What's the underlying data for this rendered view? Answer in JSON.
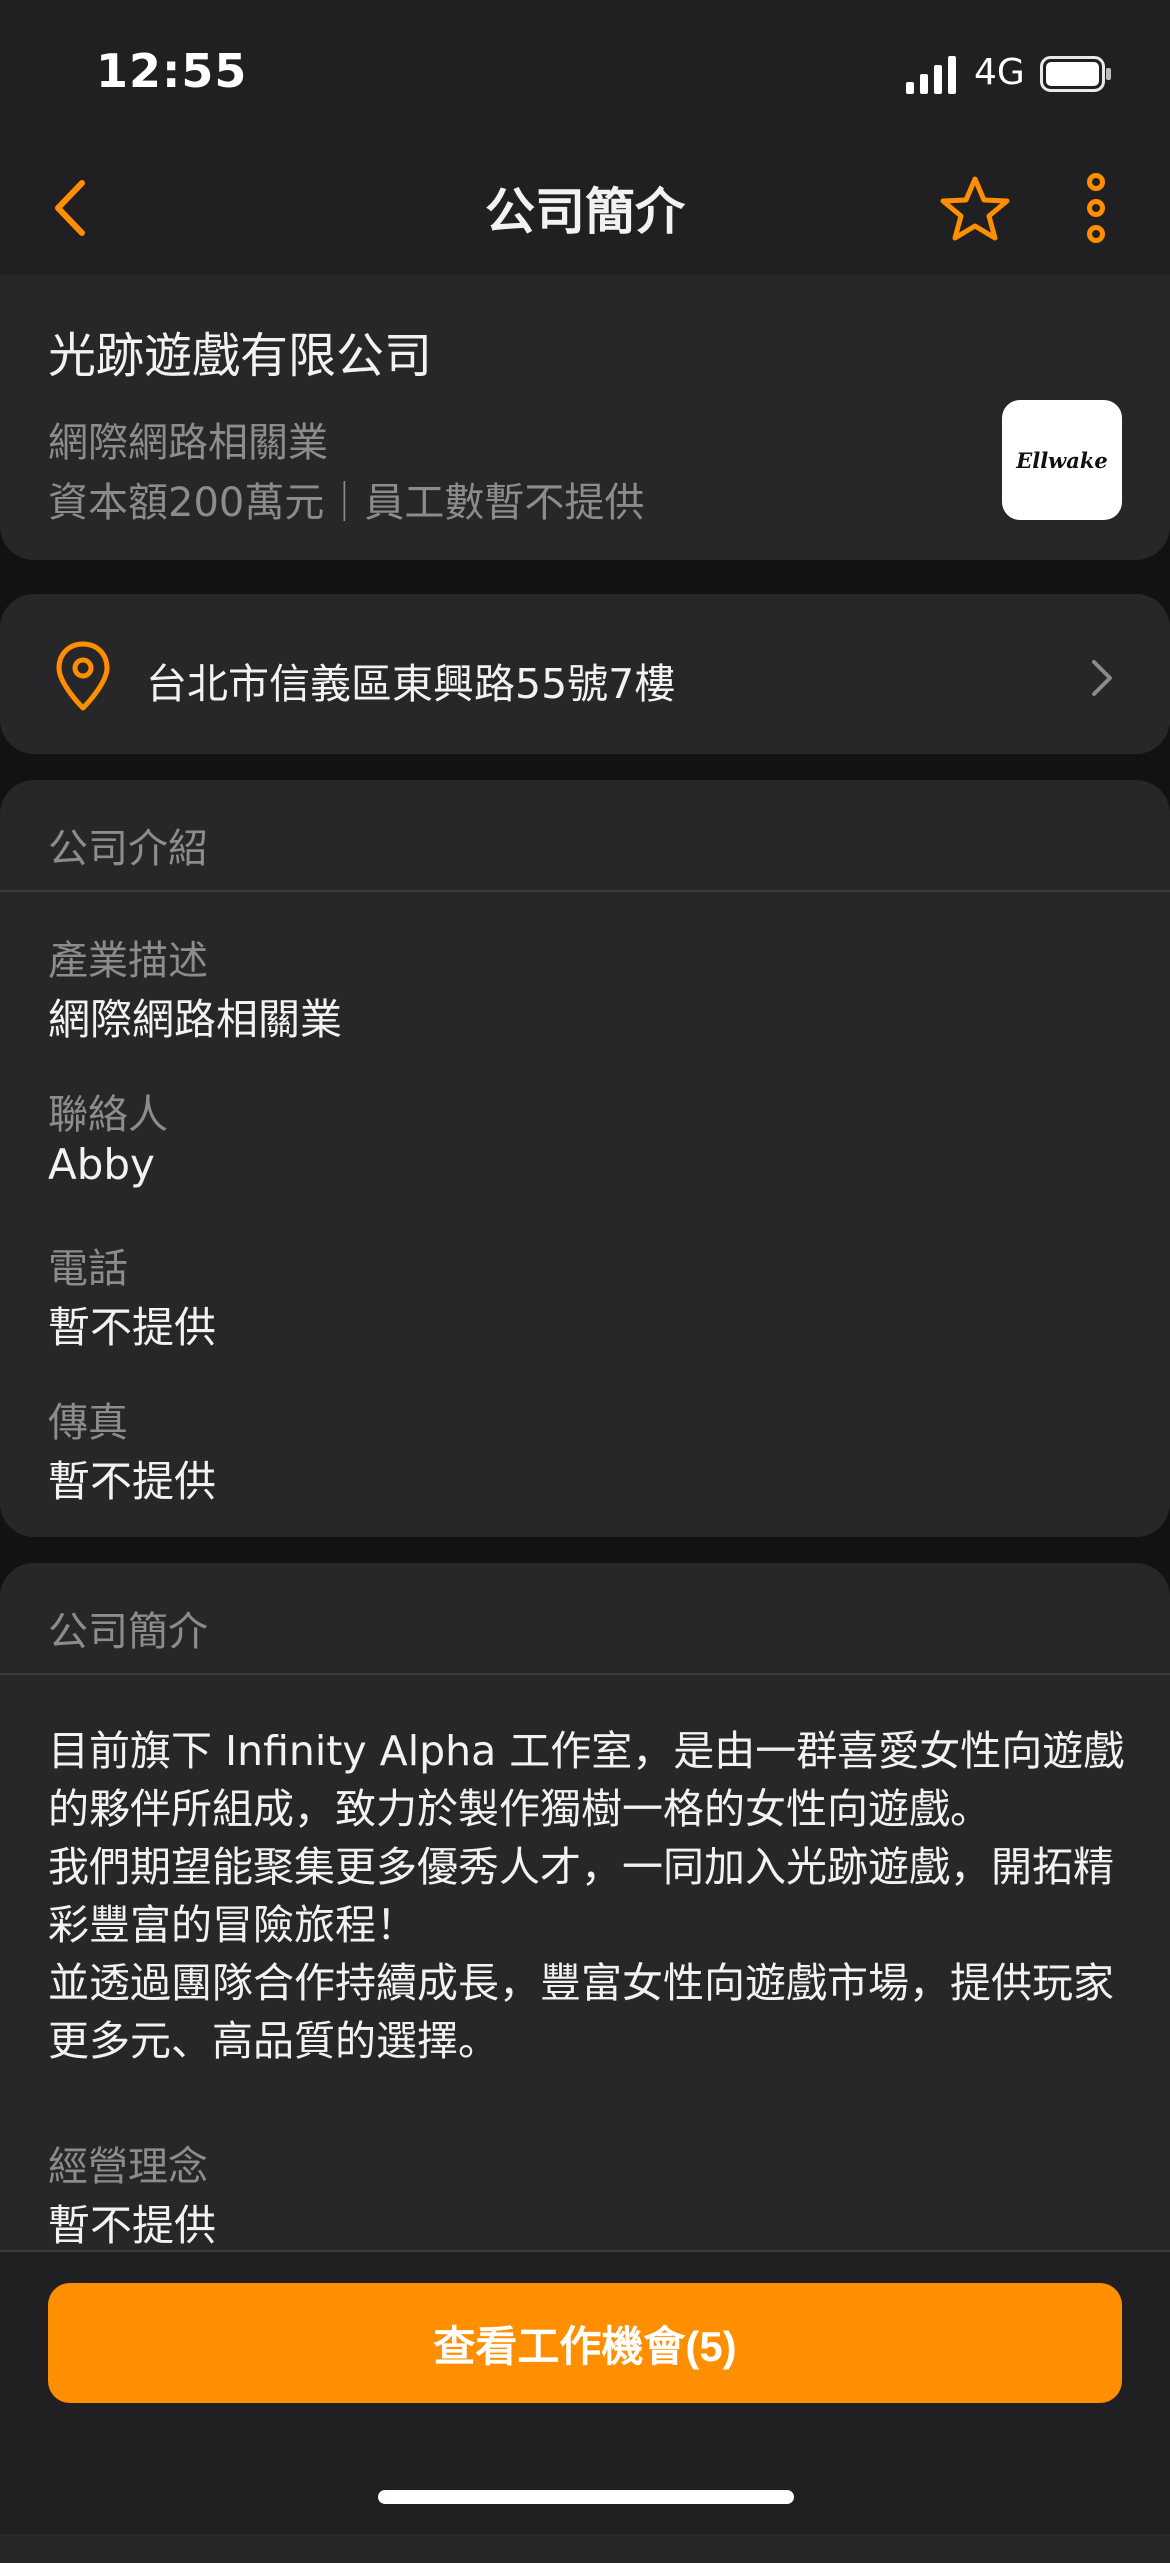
{
  "status_bar": {
    "time": "12:55",
    "network": "4G"
  },
  "nav": {
    "title": "公司簡介",
    "back_icon": "chevron-left-icon",
    "favorite_icon": "star-icon",
    "more_icon": "more-vertical-icon"
  },
  "company": {
    "name": "光跡遊戲有限公司",
    "industry": "網際網路相關業",
    "capital_line": "資本額200萬元｜員工數暫不提供",
    "logo_text": "Ellwake"
  },
  "address": {
    "text": "台北市信義區東興路55號7樓",
    "icon": "location-pin-icon"
  },
  "intro": {
    "title": "公司介紹",
    "fields": [
      {
        "label": "產業描述",
        "value": "網際網路相關業"
      },
      {
        "label": "聯絡人",
        "value": "Abby"
      },
      {
        "label": "電話",
        "value": "暫不提供"
      },
      {
        "label": "傳真",
        "value": "暫不提供"
      }
    ]
  },
  "profile": {
    "title": "公司簡介",
    "description": "目前旗下 Infinity Alpha 工作室，是由一群喜愛女性向遊戲的夥伴所組成，致力於製作獨樹一格的女性向遊戲。\n我們期望能聚集更多優秀人才，一同加入光跡遊戲，開拓精彩豐富的冒險旅程！\n並透過團隊合作持續成長，豐富女性向遊戲市場，提供玩家更多元、高品質的選擇。",
    "philosophy_label": "經營理念",
    "philosophy_value": "暫不提供"
  },
  "cta": {
    "label": "查看工作機會(5)"
  },
  "colors": {
    "accent": "#ff8f00",
    "background": "#121212",
    "card": "#27272a"
  }
}
